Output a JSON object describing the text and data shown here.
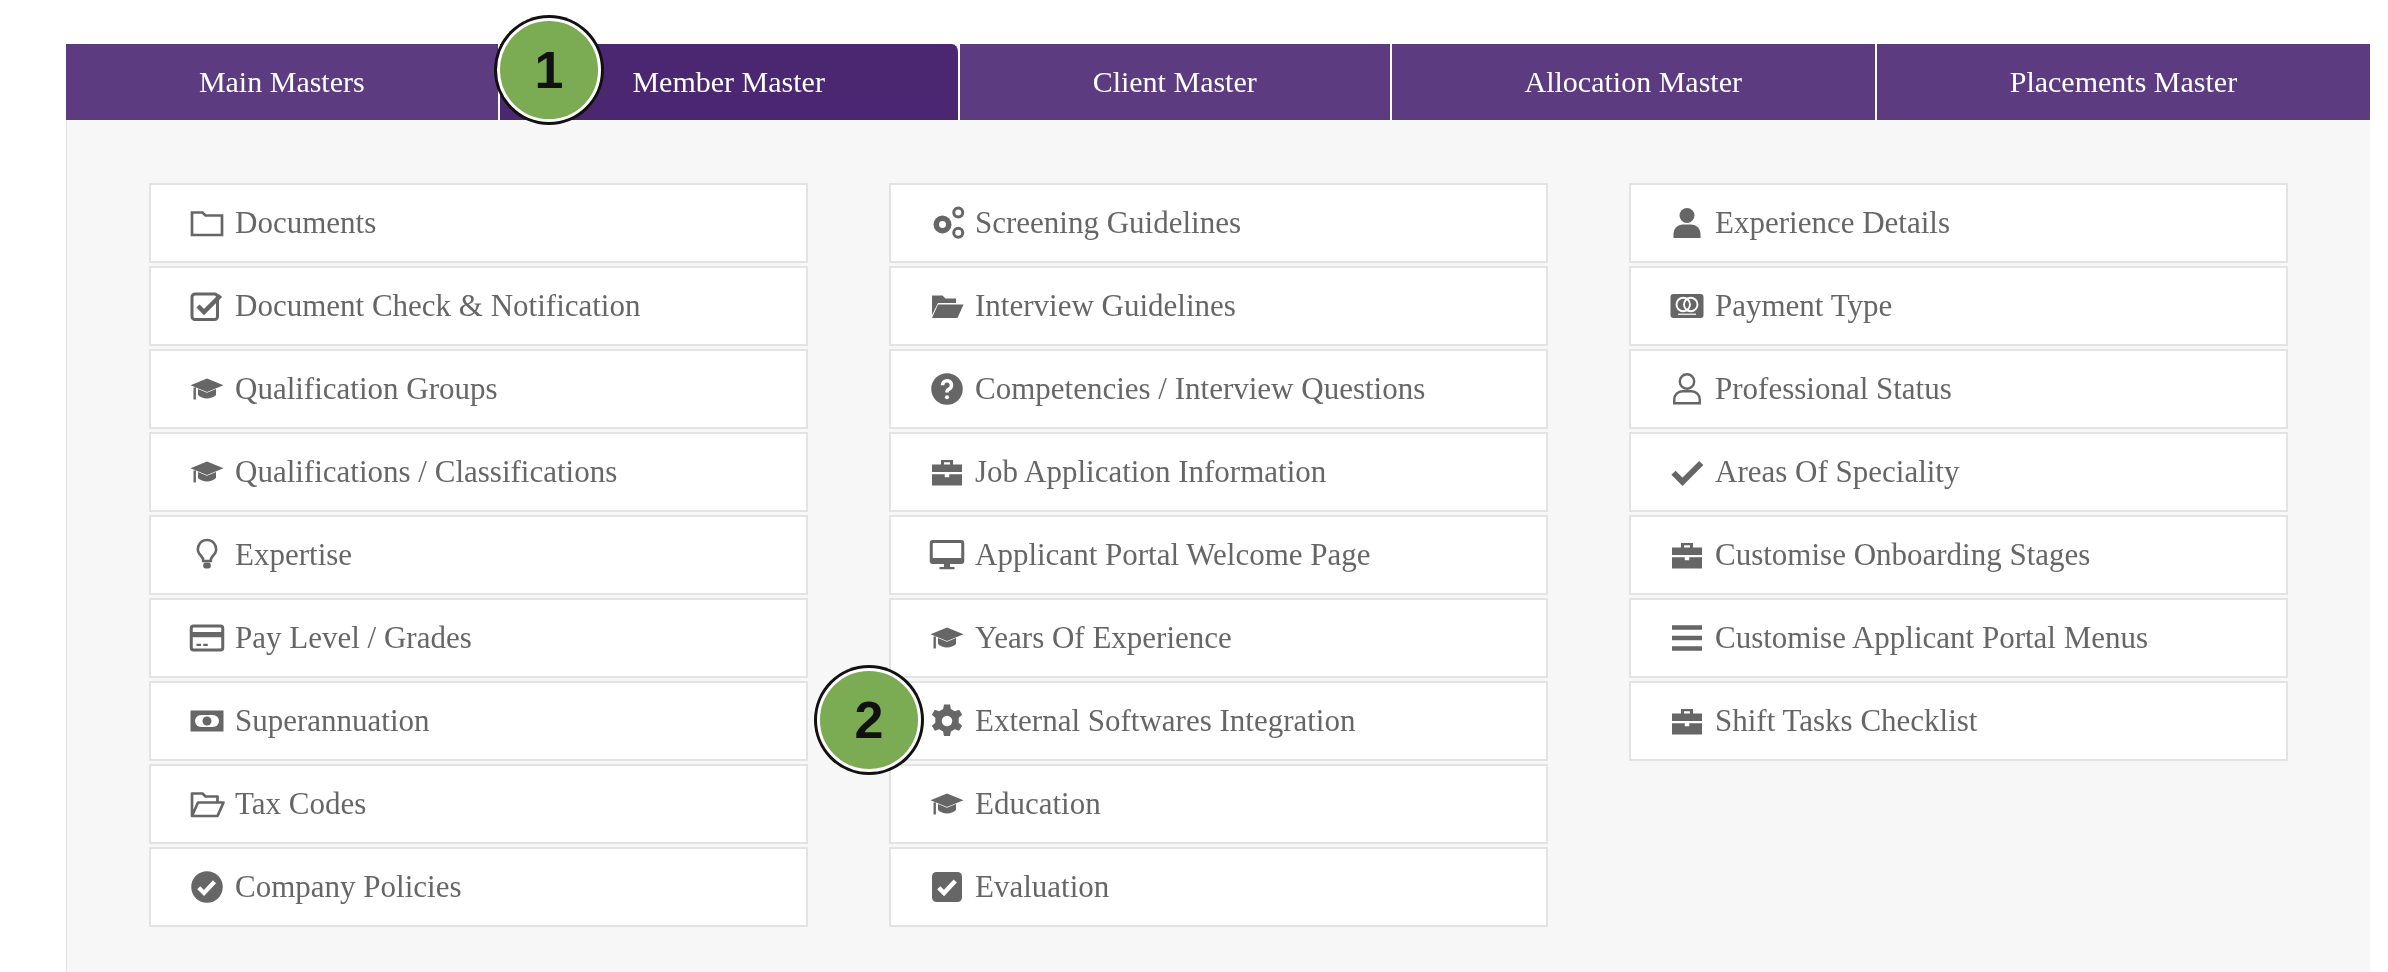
{
  "tabs": [
    {
      "label": "Main Masters",
      "selected": false
    },
    {
      "label": "Member Master",
      "selected": true
    },
    {
      "label": "Client Master",
      "selected": false
    },
    {
      "label": "Allocation Master",
      "selected": false
    },
    {
      "label": "Placements Master",
      "selected": false
    }
  ],
  "columns": [
    {
      "items": [
        "Documents",
        "Document Check & Notification",
        "Qualification Groups",
        "Qualifications / Classifications",
        "Expertise",
        "Pay Level / Grades",
        "Superannuation",
        "Tax Codes",
        "Company Policies"
      ]
    },
    {
      "items": [
        "Screening Guidelines",
        "Interview Guidelines",
        "Competencies / Interview Questions",
        "Job Application Information",
        "Applicant Portal Welcome Page",
        "Years Of Experience",
        "External Softwares Integration",
        "Education",
        "Evaluation"
      ]
    },
    {
      "items": [
        "Experience Details",
        "Payment Type",
        "Professional Status",
        "Areas Of Speciality",
        "Customise Onboarding Stages",
        "Customise Applicant Portal Menus",
        "Shift Tasks Checklist"
      ]
    }
  ],
  "callouts": [
    {
      "label": "1"
    },
    {
      "label": "2"
    }
  ]
}
